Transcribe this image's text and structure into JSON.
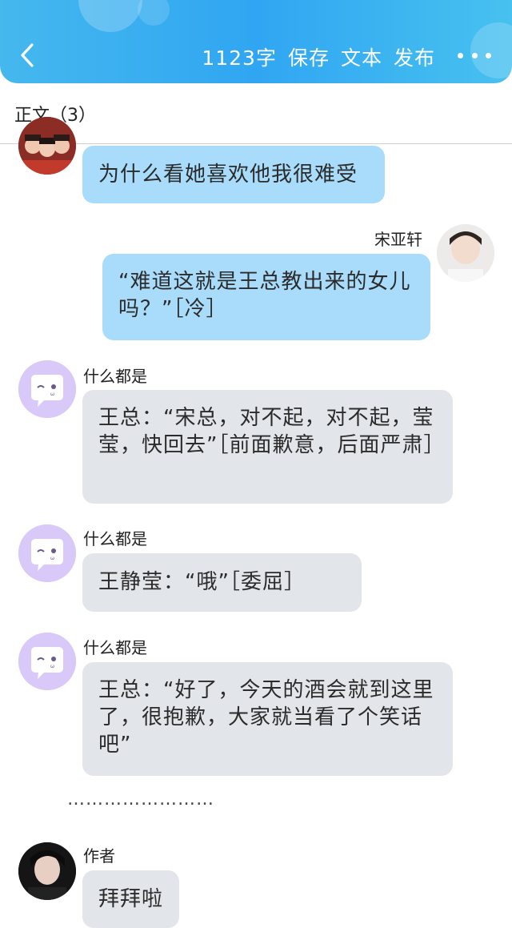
{
  "header": {
    "word_count": "1123字",
    "save": "保存",
    "text": "文本",
    "publish": "发布"
  },
  "section": {
    "title": "正文（3）"
  },
  "messages": [
    {
      "text": "为什么看她喜欢他我很难受"
    },
    {
      "speaker": "宋亚轩",
      "text": "“难道这就是王总教出来的女儿吗？”［冷］"
    },
    {
      "speaker": "什么都是",
      "text": "王总：“宋总，对不起，对不起，莹莹，快回去”［前面歉意，后面严肃］"
    },
    {
      "speaker": "什么都是",
      "text": "王静莹：“哦”［委屈］"
    },
    {
      "speaker": "什么都是",
      "text": "王总：“好了，今天的酒会就到这里了，很抱歉，大家就当看了个笑话吧”"
    },
    {
      "speaker": "作者",
      "text": "拜拜啦"
    }
  ],
  "separator": "……………………",
  "colors": {
    "header_blue": "#30a6f2",
    "bubble_blue": "#a8dcfa",
    "bubble_grey": "#e2e5ea",
    "robot_purple": "#d9c9f8"
  }
}
